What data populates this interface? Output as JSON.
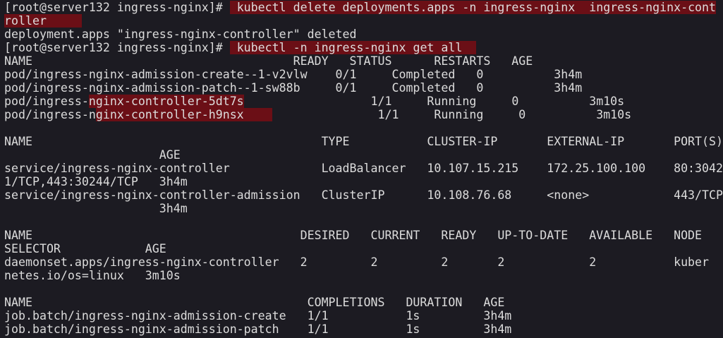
{
  "terminal": {
    "lines": [
      {
        "text": "[root@server132 ingress-nginx]# ",
        "hl": " kubectl delete deployments.apps -n ingress-nginx  ingress-nginx-cont"
      },
      {
        "text": "",
        "hl": "roller     "
      },
      {
        "text": "deployment.apps \"ingress-nginx-controller\" deleted",
        "hl": ""
      },
      {
        "text": "[root@server132 ingress-nginx]# ",
        "hl": " kubectl -n ingress-nginx get all  "
      },
      {
        "text": "NAME                                     READY   STATUS      RESTARTS   AGE",
        "hl": ""
      },
      {
        "text": "pod/ingress-nginx-admission-create--1-v2vlw    0/1     Completed   0          3h4m",
        "hl": ""
      },
      {
        "text": "pod/ingress-nginx-admission-patch--1-sw88b     0/1     Completed   0          3h4m",
        "hl": ""
      },
      {
        "text": "pod/ingress-",
        "hl": "nginx-controller-5dt7s",
        "rest": "                  1/1     Running     0          3m10s"
      },
      {
        "text": "pod/ingress-n",
        "hl": "ginx-controller-h9nsx    ",
        "rest": "               1/1     Running     0          3m10s"
      },
      {
        "text": "",
        "hl": ""
      },
      {
        "text": "NAME                                         TYPE           CLUSTER-IP       EXTERNAL-IP       PORT(S)",
        "hl": ""
      },
      {
        "text": "                      AGE",
        "hl": ""
      },
      {
        "text": "service/ingress-nginx-controller             LoadBalancer   10.107.15.215    172.25.100.100    80:3042",
        "hl": ""
      },
      {
        "text": "1/TCP,443:30244/TCP   3h4m",
        "hl": ""
      },
      {
        "text": "service/ingress-nginx-controller-admission   ClusterIP      10.108.76.68     <none>            443/TCP",
        "hl": ""
      },
      {
        "text": "                      3h4m",
        "hl": ""
      },
      {
        "text": "",
        "hl": ""
      },
      {
        "text": "NAME                                      DESIRED   CURRENT   READY   UP-TO-DATE   AVAILABLE   NODE ",
        "hl": ""
      },
      {
        "text": "SELECTOR            AGE",
        "hl": ""
      },
      {
        "text": "daemonset.apps/ingress-nginx-controller   2         2         2       2            2           kuber",
        "hl": ""
      },
      {
        "text": "netes.io/os=linux   3m10s",
        "hl": ""
      },
      {
        "text": "",
        "hl": ""
      },
      {
        "text": "NAME                                       COMPLETIONS   DURATION   AGE",
        "hl": ""
      },
      {
        "text": "job.batch/ingress-nginx-admission-create   1/1           1s         3h4m",
        "hl": ""
      },
      {
        "text": "job.batch/ingress-nginx-admission-patch    1/1           1s         3h4m",
        "hl": ""
      }
    ]
  }
}
